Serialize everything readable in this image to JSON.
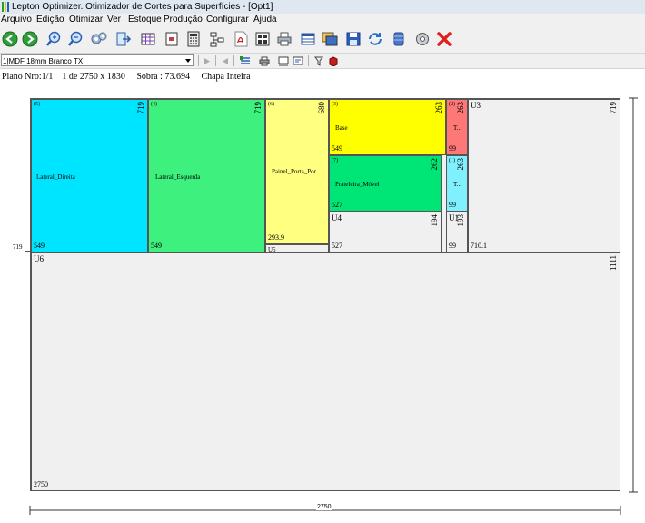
{
  "window": {
    "title": "Lepton Optimizer. Otimizador de Cortes para Superfícies - [Opt1]"
  },
  "menu": [
    "Arquivo",
    "Edição",
    "Otimizar",
    "Ver",
    "Estoque",
    "Produção",
    "Configurar",
    "Ajuda"
  ],
  "toolbar": {
    "material_select": "1|MDF 18mm Branco TX"
  },
  "info": {
    "plan": "Plano Nro:1/1",
    "of": "1 de 2750 x 1830",
    "leftover": "Sobra : 73.694",
    "sheet_type": "Chapa Inteira"
  },
  "sheet": {
    "width": "2750",
    "height_marker": "719"
  },
  "pieces": [
    {
      "num": "(5)",
      "name": "Lateral_Direita",
      "w": "549",
      "h": "719",
      "color": "#00e5ff"
    },
    {
      "num": "(4)",
      "name": "Lateral_Esquerda",
      "w": "549",
      "h": "719",
      "color": "#3ef07e"
    },
    {
      "num": "(6)",
      "name": "Painel_Porta_Por...",
      "w": "293.9",
      "h": "680",
      "color": "#ffff80"
    },
    {
      "num": "(3)",
      "name": "Base",
      "w": "549",
      "h": "263",
      "color": "#ffff00"
    },
    {
      "num": "(2)",
      "name": "T...",
      "w": "99",
      "h": "263",
      "color": "#ff7878"
    },
    {
      "num": "(7)",
      "name": "Prateleira_Móvel",
      "w": "527",
      "h": "262",
      "color": "#00e676"
    },
    {
      "num": "(1)",
      "name": "T...",
      "w": "99",
      "h": "263",
      "color": "#80f0ff"
    }
  ],
  "leftovers": [
    {
      "label": "U3",
      "w": "710.1",
      "h": "719"
    },
    {
      "label": "U4",
      "w": "527",
      "h": "194"
    },
    {
      "label": "U1",
      "w": "99",
      "h": "193"
    },
    {
      "label": "U5",
      "w": "",
      "h": ""
    },
    {
      "label": "U6",
      "w": "2750",
      "h": "1111"
    }
  ]
}
